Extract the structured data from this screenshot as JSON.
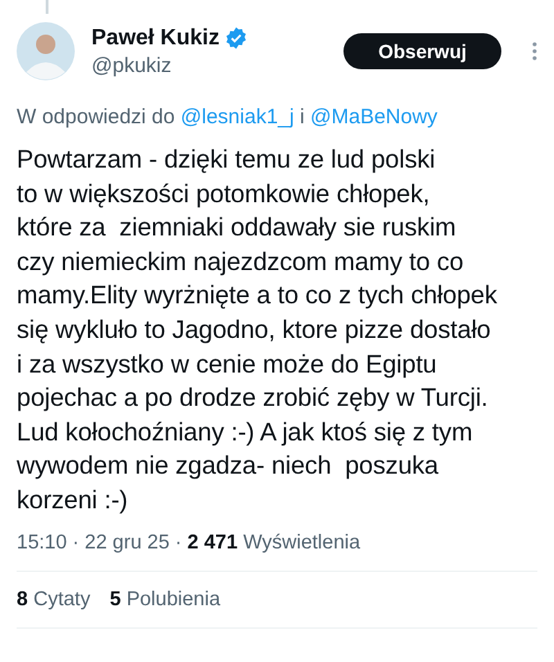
{
  "author": {
    "name": "Paweł Kukiz",
    "verified": true,
    "handle": "@pkukiz"
  },
  "follow_button": "Obserwuj",
  "reply_to": {
    "prefix": "W odpowiedzi do",
    "mentions": [
      "@lesniak1_j",
      "@MaBeNowy"
    ],
    "joiner": "i"
  },
  "body_lines": [
    "Powtarzam - dzięki temu ze lud polski",
    "to w większości potomkowie chłopek,",
    "które za  ziemniaki oddawały sie ruskim",
    "czy niemieckim najezdzcom mamy to co",
    "mamy.Elity wyrżnięte a to co z tych chłopek",
    "się wykluło to Jagodno, ktore pizze dostało",
    "i za wszystko w cenie może do Egiptu",
    "pojechac a po drodze zrobić zęby w Turcji.",
    "Lud kołochoźniany :-) A jak ktoś się z tym",
    "wywodem nie zgadza- niech  poszuka",
    "korzeni :-)"
  ],
  "meta": {
    "time": "15:10",
    "separator": "·",
    "date": "22 gru 25",
    "views_count": "2 471",
    "views_label": "Wyświetlenia"
  },
  "stats": [
    {
      "count": "8",
      "label": "Cytaty"
    },
    {
      "count": "5",
      "label": "Polubienia"
    }
  ]
}
